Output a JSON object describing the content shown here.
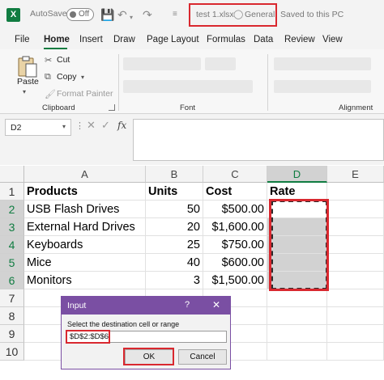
{
  "titlebar": {
    "app_icon": "X",
    "autosave_label": "AutoSave",
    "autosave_state": "Off",
    "undo_icon": "undo-icon",
    "redo_icon": "redo-icon",
    "file_name": "test 1.xlsx",
    "sensitivity": "General",
    "saved_status": "Saved to this PC",
    "highlight_color": "#d9282f"
  },
  "menu": {
    "tabs": [
      "File",
      "Home",
      "Insert",
      "Draw",
      "Page Layout",
      "Formulas",
      "Data",
      "Review",
      "View"
    ],
    "active": "Home",
    "accent": "#107c41"
  },
  "ribbon": {
    "paste_label": "Paste",
    "cut_label": "Cut",
    "copy_label": "Copy",
    "format_painter_label": "Format Painter",
    "clipboard_label": "Clipboard",
    "font_label": "Font",
    "alignment_label": "Alignment"
  },
  "formula_bar": {
    "name_box": "D2",
    "fx": "fx",
    "content": ""
  },
  "sheet": {
    "columns": [
      "A",
      "B",
      "C",
      "D",
      "E"
    ],
    "rows": [
      "1",
      "2",
      "3",
      "4",
      "5",
      "6",
      "7",
      "8",
      "9",
      "10"
    ],
    "headers": [
      "Products",
      "Units",
      "Cost",
      "Rate"
    ],
    "data": [
      {
        "product": "USB Flash Drives",
        "units": "50",
        "cost": "$500.00",
        "rate": ""
      },
      {
        "product": "External Hard Drives",
        "units": "20",
        "cost": "$1,600.00",
        "rate": ""
      },
      {
        "product": "Keyboards",
        "units": "25",
        "cost": "$750.00",
        "rate": ""
      },
      {
        "product": "Mice",
        "units": "40",
        "cost": "$600.00",
        "rate": ""
      },
      {
        "product": "Monitors",
        "units": "3",
        "cost": "$1,500.00",
        "rate": ""
      }
    ],
    "selected_range": "D2:D6"
  },
  "dialog": {
    "title": "Input",
    "help": "?",
    "close": "✕",
    "prompt": "Select the destination cell or range",
    "value": "$D$2:$D$6",
    "ok_label": "OK",
    "cancel_label": "Cancel",
    "title_color": "#7a4fa3"
  }
}
